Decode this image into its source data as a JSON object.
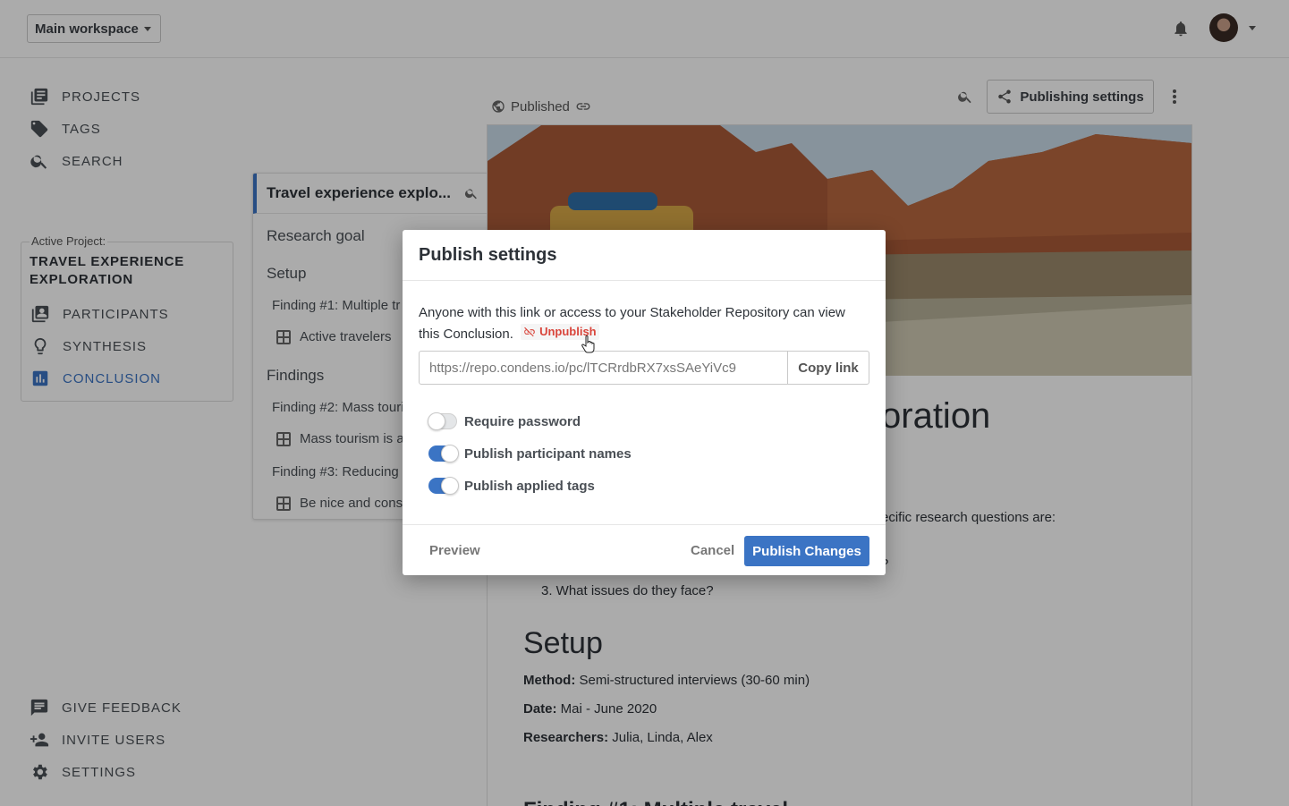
{
  "colors": {
    "accent": "#3b74c4",
    "danger": "#d9443a"
  },
  "topbar": {
    "workspace": "Main workspace",
    "icons": [
      "bell-icon",
      "avatar",
      "chevron-down-icon"
    ]
  },
  "sidebar": {
    "nav": [
      {
        "label": "PROJECTS",
        "icon": "library-icon"
      },
      {
        "label": "TAGS",
        "icon": "tag-icon"
      },
      {
        "label": "SEARCH",
        "icon": "search-icon"
      }
    ],
    "active_project_label": "Active Project:",
    "active_project_name": "TRAVEL EXPERIENCE EXPLORATION",
    "project_nav": [
      {
        "label": "PARTICIPANTS",
        "icon": "contacts-icon"
      },
      {
        "label": "SYNTHESIS",
        "icon": "lightbulb-icon"
      },
      {
        "label": "CONCLUSION",
        "icon": "chart-icon",
        "active": true
      }
    ],
    "bottom_nav": [
      {
        "label": "GIVE FEEDBACK",
        "icon": "feedback-icon"
      },
      {
        "label": "INVITE USERS",
        "icon": "add-user-icon"
      },
      {
        "label": "SETTINGS",
        "icon": "gear-icon"
      }
    ]
  },
  "outline": {
    "title": "Travel experience explo...",
    "items": [
      {
        "label": "Research goal",
        "level": "h"
      },
      {
        "label": "Setup",
        "level": "h"
      },
      {
        "label": "Finding #1: Multiple tr",
        "level": "f"
      },
      {
        "label": "Active travelers",
        "level": "s"
      },
      {
        "label": "Findings",
        "level": "h"
      },
      {
        "label": "Finding #2: Mass touri",
        "level": "f"
      },
      {
        "label": "Mass tourism is a",
        "level": "s"
      },
      {
        "label": "Finding #3: Reducing",
        "level": "f"
      },
      {
        "label": "Be nice and cons",
        "level": "s"
      }
    ]
  },
  "document": {
    "status": "Published",
    "publishing_settings_label": "Publishing settings",
    "title_visible": "oration",
    "intro_visible": "ecific research questions are:",
    "list_fragment": "?",
    "question_3": "3.  What issues do they face?",
    "setup_heading": "Setup",
    "method_label": "Method:",
    "method_value": " Semi-structured interviews (30-60 min)",
    "date_label": "Date:",
    "date_value": " Mai - June 2020",
    "researchers_label": "Researchers:",
    "researchers_value": " Julia, Linda, Alex",
    "next_heading_cut": "Finding #1: Multiple travel..."
  },
  "modal": {
    "title": "Publish settings",
    "description": "Anyone with this link or access to your Stakeholder Repository can view this Conclusion.",
    "unpublish_label": "Unpublish",
    "link_value": "https://repo.condens.io/pc/lTCRrdbRX7xsSAeYiVc9",
    "copy_label": "Copy link",
    "toggles": [
      {
        "label": "Require password",
        "on": false
      },
      {
        "label": "Publish participant names",
        "on": true
      },
      {
        "label": "Publish applied tags",
        "on": true
      }
    ],
    "preview_label": "Preview",
    "cancel_label": "Cancel",
    "publish_label": "Publish Changes"
  }
}
